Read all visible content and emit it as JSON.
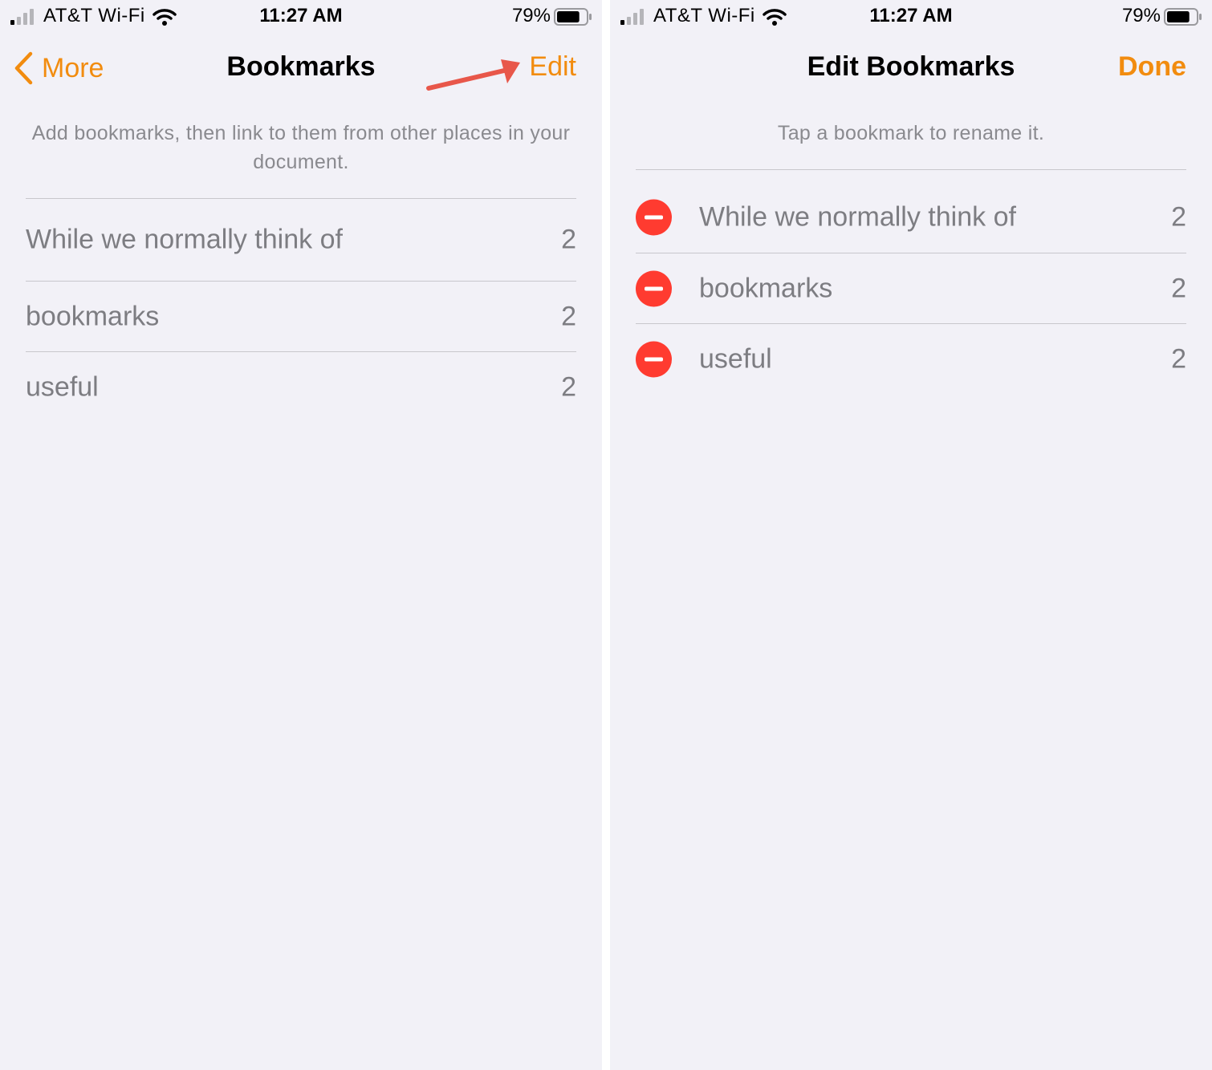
{
  "status_bar": {
    "carrier": "AT&T Wi-Fi",
    "time": "11:27 AM",
    "battery": "79%",
    "battery_level": 0.79
  },
  "left_screen": {
    "nav": {
      "back_label": "More",
      "title": "Bookmarks",
      "action_label": "Edit"
    },
    "description": "Add bookmarks, then link to them from other places in your document.",
    "bookmarks": [
      {
        "label": "While we normally think of",
        "count": "2"
      },
      {
        "label": "bookmarks",
        "count": "2"
      },
      {
        "label": "useful",
        "count": "2"
      }
    ]
  },
  "right_screen": {
    "nav": {
      "title": "Edit Bookmarks",
      "action_label": "Done"
    },
    "description": "Tap a bookmark to rename it.",
    "bookmarks": [
      {
        "label": "While we normally think of",
        "count": "2"
      },
      {
        "label": "bookmarks",
        "count": "2"
      },
      {
        "label": "useful",
        "count": "2"
      }
    ]
  },
  "colors": {
    "accent": "#f28c0f",
    "delete": "#ff3b30",
    "callout_arrow": "#e8574a",
    "background": "#f2f1f7"
  }
}
